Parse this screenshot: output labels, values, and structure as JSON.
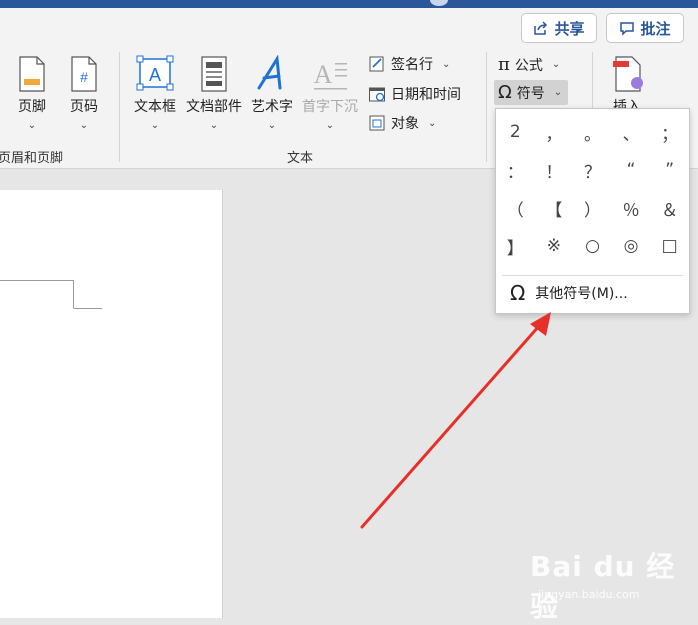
{
  "header": {
    "share_label": "共享",
    "comments_label": "批注"
  },
  "ribbon": {
    "header_footer_group": {
      "footer_label": "页脚",
      "page_number_label": "页码",
      "group_label": "页眉和页脚"
    },
    "text_group": {
      "textbox_label": "文本框",
      "quick_parts_label": "文档部件",
      "wordart_label": "艺术字",
      "dropcap_label": "首字下沉",
      "signature_line_label": "签名行",
      "datetime_label": "日期和时间",
      "object_label": "对象",
      "group_label": "文本"
    },
    "symbols_group": {
      "equation_label": "公式",
      "symbol_label": "符号"
    },
    "insert_label": "插入"
  },
  "symbol_dropdown": {
    "symbols": [
      "2",
      "，",
      "。",
      "、",
      "；",
      "：",
      "！",
      "？",
      "“",
      "”",
      "（",
      "【",
      "）",
      "％",
      "＆",
      "】",
      "※",
      "○",
      "◎",
      "□"
    ],
    "more_label": "其他符号(M)..."
  },
  "watermark": {
    "brand": "Bai du 经验",
    "url": "jingyan.baidu.com"
  },
  "colors": {
    "accent": "#2b579a",
    "arrow": "#e8302a",
    "wordart": "#1e73d6"
  }
}
